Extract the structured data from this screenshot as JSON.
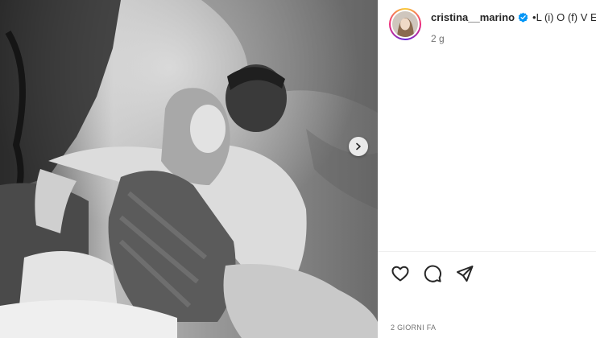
{
  "post": {
    "media": {
      "description_icon": "photo",
      "next_icon": "chevron-right-icon"
    },
    "author": {
      "username": "cristina__marino",
      "verified_icon": "verified-badge-icon",
      "accent_color": "#0095f6"
    },
    "caption": "•L (i) O (f) V E",
    "relative_time": "2 g",
    "actions": {
      "like_icon": "heart-icon",
      "comment_icon": "comment-icon",
      "share_icon": "paper-plane-icon"
    },
    "timestamp": "2 GIORNI FA"
  }
}
